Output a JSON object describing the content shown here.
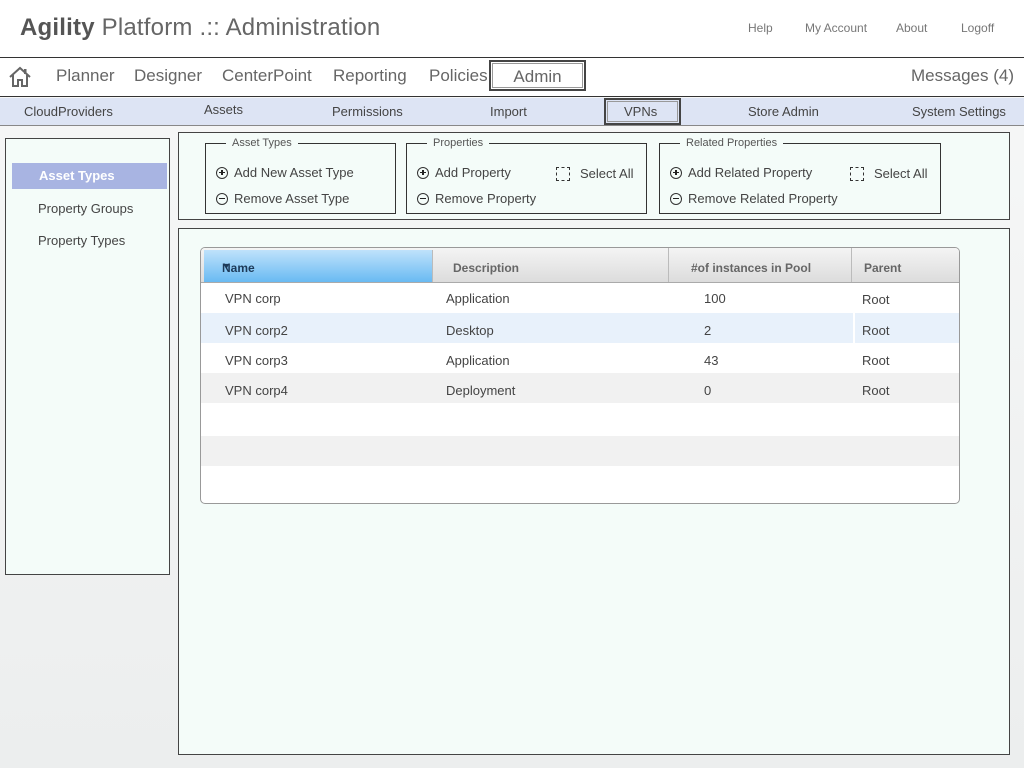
{
  "header": {
    "brand_bold": "Agility",
    "brand_rest": "Platform .:: Administration",
    "links": [
      "Help",
      "My Account",
      "About",
      "Logoff"
    ]
  },
  "mainnav": {
    "items": [
      "Planner",
      "Designer",
      "CenterPoint",
      "Reporting",
      "Policies",
      "Admin"
    ],
    "active": "Admin",
    "messages": "Messages (4)"
  },
  "subnav": {
    "items": [
      "CloudProviders",
      "Assets",
      "Permissions",
      "Import",
      "VPNs",
      "Store Admin",
      "System Settings"
    ],
    "active": "VPNs"
  },
  "leftpanel": {
    "items": [
      "Asset Types",
      "Property Groups",
      "Property Types"
    ],
    "active": "Asset Types"
  },
  "toolbar": {
    "asset_types": {
      "legend": "Asset Types",
      "add": "Add New Asset Type",
      "remove": "Remove Asset Type"
    },
    "properties": {
      "legend": "Properties",
      "add": "Add Property",
      "remove": "Remove Property",
      "select_all": "Select All"
    },
    "related": {
      "legend": "Related Properties",
      "add": "Add Related Property",
      "remove": "Remove Related Property",
      "select_all": "Select All"
    }
  },
  "table": {
    "columns": [
      "Name",
      "Description",
      "#of instances in Pool",
      "Parent"
    ],
    "rows": [
      {
        "name": "VPN corp",
        "description": "Application",
        "instances": "100",
        "parent": "Root"
      },
      {
        "name": "VPN corp2",
        "description": "Desktop",
        "instances": "2",
        "parent": "Root"
      },
      {
        "name": "VPN corp3",
        "description": "Application",
        "instances": "43",
        "parent": "Root"
      },
      {
        "name": "VPN corp4",
        "description": "Deployment",
        "instances": "0",
        "parent": "Root"
      }
    ]
  },
  "colors": {
    "subnav_bg": "#dde4f4",
    "leftpanel_active_bg": "#a8b4e2",
    "panel_bg": "#f4fcf9",
    "sorted_header": "#69baf2"
  },
  "icons": {
    "home": "home-icon",
    "sort": "sort-desc-icon",
    "add": "plus-circle-icon",
    "remove": "minus-circle-icon",
    "checkbox": "dashed-checkbox-icon"
  }
}
